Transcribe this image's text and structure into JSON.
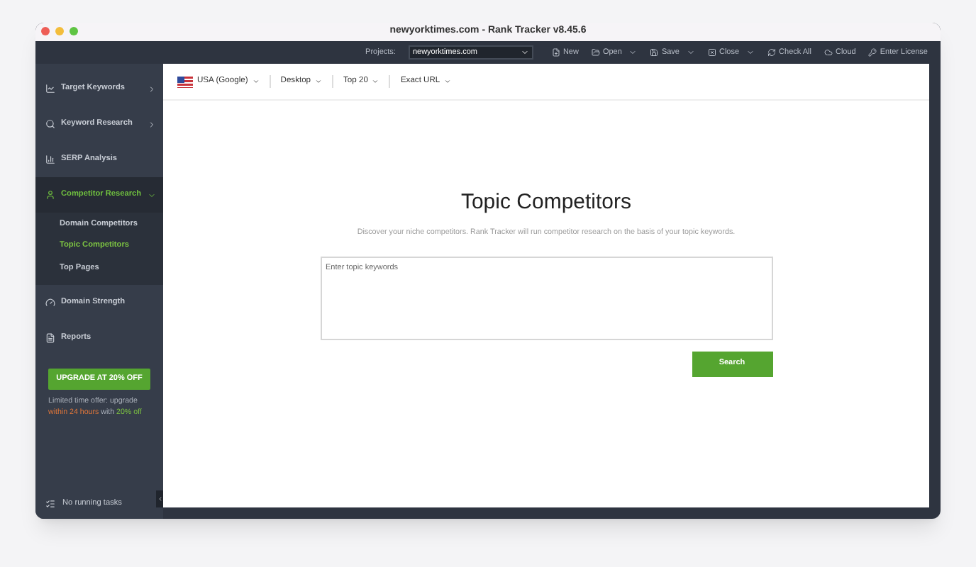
{
  "window": {
    "title": "newyorktimes.com - Rank Tracker v8.45.6"
  },
  "toolbar": {
    "projects_label": "Projects:",
    "project": "newyorktimes.com",
    "buttons": [
      {
        "label": "New",
        "kind": "new",
        "has_menu": false
      },
      {
        "label": "Open",
        "kind": "open",
        "has_menu": true
      },
      {
        "label": "Save",
        "kind": "save",
        "has_menu": true
      },
      {
        "label": "Close",
        "kind": "close",
        "has_menu": true
      },
      {
        "label": "Check All",
        "kind": "refresh",
        "has_menu": false
      },
      {
        "label": "Cloud",
        "kind": "cloud",
        "has_menu": false
      },
      {
        "label": "Enter License",
        "kind": "key",
        "has_menu": false
      }
    ]
  },
  "sidebar": {
    "items": [
      {
        "label": "Target Keywords",
        "kind": "chart",
        "selected": false,
        "expandable": true,
        "expanded": false
      },
      {
        "label": "Keyword Research",
        "kind": "search",
        "selected": false,
        "expandable": true,
        "expanded": false
      },
      {
        "label": "SERP Analysis",
        "kind": "bars",
        "selected": false,
        "expandable": false,
        "expanded": false
      },
      {
        "label": "Competitor Research",
        "kind": "person",
        "selected": true,
        "expandable": true,
        "expanded": true,
        "children": [
          {
            "label": "Domain Competitors",
            "selected": false
          },
          {
            "label": "Topic Competitors",
            "selected": true
          },
          {
            "label": "Top Pages",
            "selected": false
          }
        ]
      },
      {
        "label": "Domain Strength",
        "kind": "gauge",
        "selected": false,
        "expandable": false,
        "expanded": false
      },
      {
        "label": "Reports",
        "kind": "report",
        "selected": false,
        "expandable": false,
        "expanded": false
      }
    ],
    "upgrade_button": "UPGRADE AT 20% OFF",
    "offer": [
      {
        "text": "Limited time offer: upgrade",
        "kind": "plain"
      },
      {
        "text": "within 24 hours",
        "kind": "urgent"
      },
      {
        "text": "with",
        "kind": "plain"
      },
      {
        "text": "20% off",
        "kind": "deal"
      }
    ],
    "status": "No running tasks"
  },
  "filters": [
    {
      "label": "USA (Google)",
      "kind": "flag"
    },
    {
      "label": "Desktop",
      "kind": "plain"
    },
    {
      "label": "Top 20",
      "kind": "plain"
    },
    {
      "label": "Exact URL",
      "kind": "plain"
    }
  ],
  "main": {
    "title": "Topic Competitors",
    "description": "Discover your niche competitors. Rank Tracker will run competitor research on the basis of your topic keywords.",
    "input": {
      "placeholder": "Enter topic keywords"
    },
    "button": "Search"
  }
}
